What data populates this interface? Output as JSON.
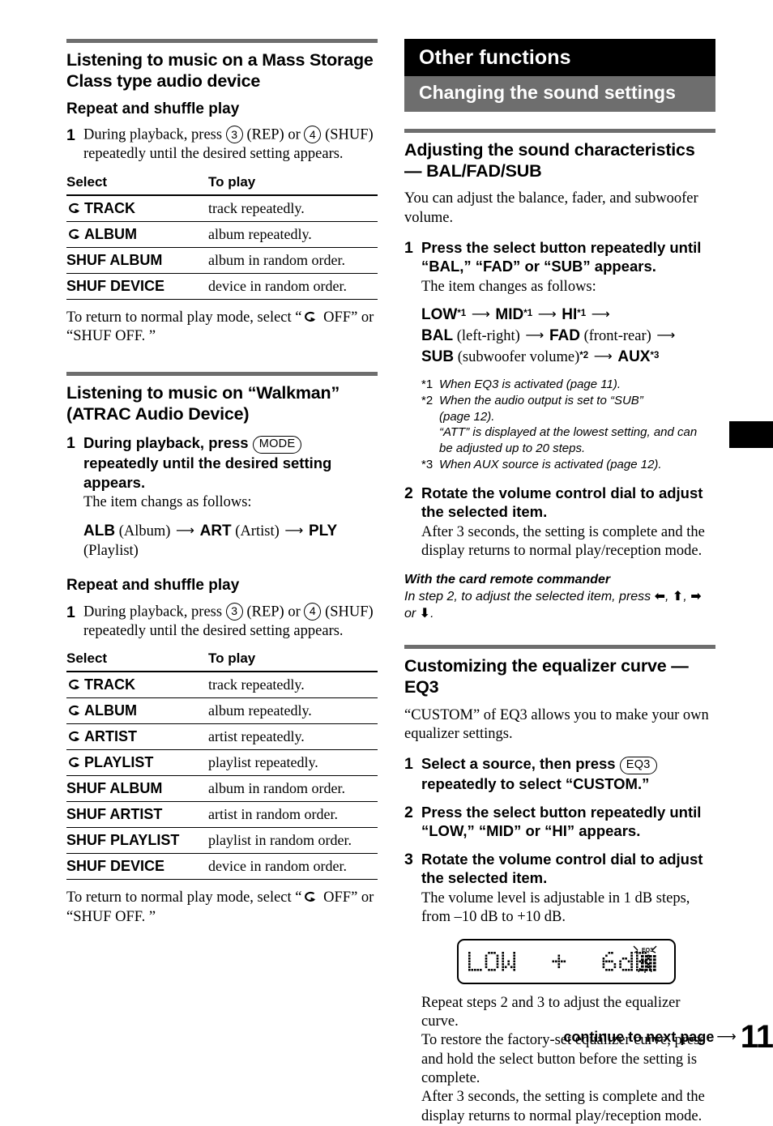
{
  "page_number": "11",
  "footer": {
    "continue_label": "continue to next page",
    "arrow": "right-arrow"
  },
  "left_column": {
    "section1": {
      "heading": "Listening to music on a Mass Storage Class type audio device",
      "subheading": "Repeat and shuffle play",
      "step1": {
        "num": "1",
        "text_a": "During playback, press",
        "key1": "3",
        "text_b": "(REP) or",
        "key2": "4",
        "text_c": "(SHUF) repeatedly until the desired setting appears."
      },
      "table": {
        "headers": [
          "Select",
          "To play"
        ],
        "rows": [
          {
            "icon": "repeat-icon",
            "select": "TRACK",
            "play": "track repeatedly."
          },
          {
            "icon": "repeat-icon",
            "select": "ALBUM",
            "play": "album repeatedly."
          },
          {
            "icon": "",
            "select": "SHUF ALBUM",
            "play": "album in random order."
          },
          {
            "icon": "",
            "select": "SHUF DEVICE",
            "play": "device in random order."
          }
        ]
      },
      "after_table_a": "To return to normal play mode, select “",
      "after_table_b": " OFF” or “SHUF OFF. ”"
    },
    "section2": {
      "heading": "Listening to music on “Walkman” (ATRAC Audio Device)",
      "step1": {
        "num": "1",
        "text_a": "During playback, press",
        "key1": "MODE",
        "text_b": "repeatedly until the desired setting appears.",
        "sub": "The item changs as follows:"
      },
      "flow": {
        "i1": "ALB",
        "l1": "(Album)",
        "i2": "ART",
        "l2": "(Artist)",
        "i3": "PLY",
        "l3": "(Playlist)"
      },
      "subheading": "Repeat and shuffle play",
      "step1b": {
        "num": "1",
        "text_a": "During playback, press",
        "key1": "3",
        "text_b": "(REP) or",
        "key2": "4",
        "text_c": "(SHUF) repeatedly until the desired setting appears."
      },
      "table": {
        "headers": [
          "Select",
          "To play"
        ],
        "rows": [
          {
            "icon": "repeat-icon",
            "select": "TRACK",
            "play": "track repeatedly."
          },
          {
            "icon": "repeat-icon",
            "select": "ALBUM",
            "play": "album repeatedly."
          },
          {
            "icon": "repeat-icon",
            "select": "ARTIST",
            "play": "artist repeatedly."
          },
          {
            "icon": "repeat-icon",
            "select": "PLAYLIST",
            "play": "playlist repeatedly."
          },
          {
            "icon": "",
            "select": "SHUF ALBUM",
            "play": "album in random order."
          },
          {
            "icon": "",
            "select": "SHUF ARTIST",
            "play": "artist in random order."
          },
          {
            "icon": "",
            "select": "SHUF PLAYLIST",
            "play": "playlist in random order."
          },
          {
            "icon": "",
            "select": "SHUF DEVICE",
            "play": "device in random order."
          }
        ]
      },
      "after_table_a": "To return to normal play mode, select “",
      "after_table_b": " OFF” or “SHUF OFF. ”"
    }
  },
  "right_column": {
    "chapter_title": "Other functions",
    "section_title": "Changing the sound settings",
    "bal_fad_sub": {
      "heading": "Adjusting the sound characteristics — BAL/FAD/SUB",
      "intro": "You can adjust the balance, fader, and subwoofer volume.",
      "step1": {
        "num": "1",
        "bold": "Press the select button repeatedly until “BAL,” “FAD” or “SUB” appears.",
        "sub": "The item changes as follows:"
      },
      "flow": {
        "i1": "LOW",
        "m1": "*1",
        "i2": "MID",
        "m2": "*1",
        "i3": "HI",
        "m3": "*1",
        "i4": "BAL",
        "l4": "(left-right)",
        "i5": "FAD",
        "l5": "(front-rear)",
        "i6": "SUB",
        "l6": "(subwoofer volume)",
        "m6": "*2",
        "i7": "AUX",
        "m7": "*3"
      },
      "footnotes": [
        {
          "mark": "*1",
          "lines": [
            "When EQ3 is activated (page 11)."
          ]
        },
        {
          "mark": "*2",
          "lines": [
            "When the audio output is set to “SUB”",
            "(page 12).",
            "“ATT” is displayed at the lowest setting, and can",
            "be adjusted up to 20 steps."
          ]
        },
        {
          "mark": "*3",
          "lines": [
            "When AUX source is activated (page 12)."
          ]
        }
      ],
      "step2": {
        "num": "2",
        "bold": "Rotate the volume control dial to adjust the selected item.",
        "sub": "After 3 seconds, the setting is complete and the display returns to normal play/reception mode."
      },
      "remote_note_title": "With the card remote commander",
      "remote_note_a": "In step 2, to adjust the selected item, press ",
      "remote_note_b": " or "
    },
    "eq3": {
      "heading": "Customizing the equalizer curve — EQ3",
      "intro": "“CUSTOM” of EQ3 allows you to make your own equalizer settings.",
      "step1": {
        "num": "1",
        "bold_a": "Select a source, then press",
        "key1": "EQ3",
        "bold_b": "repeatedly to select “CUSTOM.”"
      },
      "step2": {
        "num": "2",
        "bold": "Press the select button repeatedly until “LOW,” “MID” or “HI” appears."
      },
      "step3": {
        "num": "3",
        "bold": "Rotate the volume control dial to adjust the selected item.",
        "sub": "The volume level is adjustable in 1 dB steps, from –10 dB to +10 dB."
      },
      "display": {
        "band": "LOW",
        "sign": "+",
        "value": "6dB",
        "indicator": "EQ3"
      },
      "after_a": "Repeat steps 2 and 3 to adjust the equalizer curve.",
      "after_b": "To restore the factory-set equalizer curve, press and hold the select button before the setting is complete.",
      "after_c": "After 3 seconds, the setting is complete and the display returns to normal play/reception mode."
    }
  },
  "colors": {
    "chapter_bar": "#000000",
    "section_bar": "#6e6e6e",
    "rule": "#6e6e6e"
  }
}
